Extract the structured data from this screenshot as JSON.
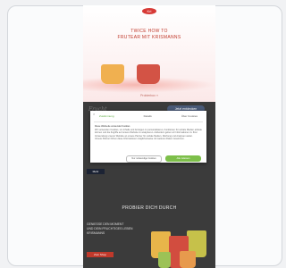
{
  "hero": {
    "logo": "Kri",
    "title_line1": "TWICE HOW TO",
    "title_line2": "FRUTEAR MIT KRISMANNS",
    "subtitle": "Probierbox  »"
  },
  "promo_row": {
    "script_label": "Frucht",
    "button_label": "Jetzt entdecken"
  },
  "consent": {
    "close_symbol": "×",
    "tabs": [
      "Zustimmung",
      "Details",
      "Über Cookies"
    ],
    "heading": "Diese Webseite verwendet Cookies",
    "lines": [
      "Wir verwenden Cookies, um Inhalte und Anzeigen zu personalisieren, Funktionen für soziale Medien anbieten zu",
      "können und die Zugriffe auf unsere Website zu analysieren. Außerdem geben wir Informationen zu Ihrer",
      "Verwendung unserer Website an unsere Partner für soziale Medien, Werbung und Analysen weiter.",
      "Unsere Partner führen diese Informationen möglicherweise mit weiteren Daten zusammen."
    ],
    "deny_label": "Nur notwendige Cookies",
    "accept_label": "Alle zulassen"
  },
  "dark_button_label": "Mehr",
  "section": {
    "title": "PROBIER DICH DURCH",
    "promo_line1": "GENIESSE DEN MOMENT",
    "promo_line2": "UND DEIN FRUCHTIGES LEBEN",
    "promo_line3": "KRISMANNS",
    "cta_label": "Zum Shop"
  }
}
